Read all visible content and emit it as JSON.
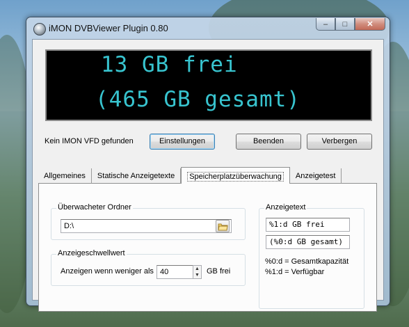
{
  "window": {
    "title": "iMON DVBViewer Plugin 0.80",
    "caption_buttons": {
      "minimize": "–",
      "maximize": "□",
      "close": "✕"
    }
  },
  "vfd": {
    "line1": "13 GB frei",
    "line2": "(465 GB gesamt)",
    "text_color": "#38c4cf"
  },
  "status": {
    "text": "Kein IMON VFD gefunden"
  },
  "buttons": {
    "settings": "Einstellungen",
    "quit": "Beenden",
    "hide": "Verbergen"
  },
  "tabs": [
    {
      "label": "Allgemeines"
    },
    {
      "label": "Statische Anzeigetexte"
    },
    {
      "label": "Speicherplatzüberwachung",
      "active": true
    },
    {
      "label": "Anzeigetest"
    }
  ],
  "watched_folder": {
    "group_label": "Überwacheter Ordner",
    "value": "D:\\"
  },
  "threshold": {
    "group_label": "Anzeigeschwellwert",
    "prefix": "Anzeigen wenn weniger als",
    "value": "40",
    "suffix": "GB frei"
  },
  "display_text": {
    "group_label": "Anzeigetext",
    "line1": "%1:d GB frei",
    "line2": "(%0:d GB gesamt)",
    "legend1": "%0:d = Gesamtkapazität",
    "legend2": "%1:d = Verfügbar"
  }
}
